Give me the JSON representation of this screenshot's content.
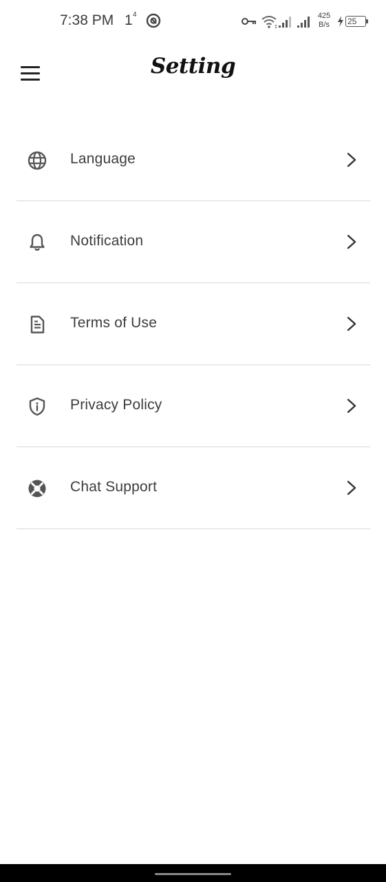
{
  "status_bar": {
    "time": "7:38 PM",
    "indicator": "1",
    "indicator_sup": "4",
    "net_speed_value": "425",
    "net_speed_unit": "B/s",
    "battery": "25"
  },
  "header": {
    "title": "Setting",
    "menu_icon": "hamburger-menu-icon"
  },
  "settings": {
    "items": [
      {
        "label": "Language",
        "icon": "globe-icon"
      },
      {
        "label": "Notification",
        "icon": "bell-icon"
      },
      {
        "label": "Terms of Use",
        "icon": "document-icon"
      },
      {
        "label": "Privacy Policy",
        "icon": "shield-info-icon"
      },
      {
        "label": "Chat Support",
        "icon": "lifebuoy-icon"
      }
    ]
  },
  "colors": {
    "background": "#ffffff",
    "text": "#3c3c3c",
    "divider": "#d8d8d8",
    "nav_bar": "#000000"
  }
}
